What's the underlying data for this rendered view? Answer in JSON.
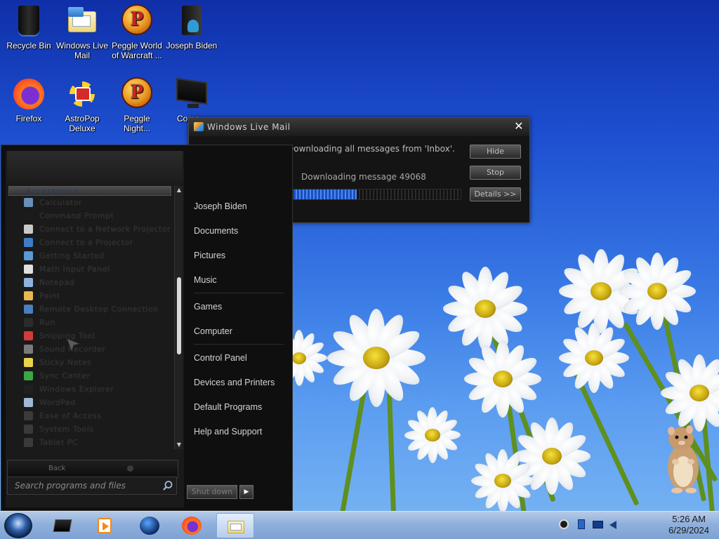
{
  "desktop": {
    "icons": [
      {
        "label": "Recycle Bin",
        "icon": "recycle-bin-icon"
      },
      {
        "label": "Windows Live Mail",
        "icon": "mail-icon"
      },
      {
        "label": "Peggle World of Warcraft ...",
        "icon": "peggle-icon"
      },
      {
        "label": "Joseph Biden",
        "icon": "user-folder-icon"
      },
      {
        "label": "Firefox",
        "icon": "firefox-icon"
      },
      {
        "label": "AstroPop Deluxe",
        "icon": "astropop-icon"
      },
      {
        "label": "Peggle Night...",
        "icon": "peggle-icon"
      },
      {
        "label": "Comp...",
        "icon": "computer-icon"
      }
    ]
  },
  "wlm_dialog": {
    "title": "Windows Live Mail",
    "status": "Downloading all messages from 'Inbox'.",
    "detail": "Downloading message 49068",
    "progress": 0.38,
    "buttons": {
      "hide": "Hide",
      "stop": "Stop",
      "details": "Details >>"
    }
  },
  "start_menu": {
    "folder": "Accessories",
    "programs": [
      {
        "label": "Calculator",
        "color": "#6a8fb8"
      },
      {
        "label": "Command Prompt",
        "color": "#1b1b1b"
      },
      {
        "label": "Connect to a Network Projector",
        "color": "#c9c9c9"
      },
      {
        "label": "Connect to a Projector",
        "color": "#3e7dc8"
      },
      {
        "label": "Getting Started",
        "color": "#5b9bd5"
      },
      {
        "label": "Math Input Panel",
        "color": "#e0e0e0"
      },
      {
        "label": "Notepad",
        "color": "#8fb3de"
      },
      {
        "label": "Paint",
        "color": "#e6b84f"
      },
      {
        "label": "Remote Desktop Connection",
        "color": "#4a7fc2"
      },
      {
        "label": "Run",
        "color": "#2b2b2b"
      },
      {
        "label": "Snipping Tool",
        "color": "#d23b3b"
      },
      {
        "label": "Sound Recorder",
        "color": "#7a7a7a"
      },
      {
        "label": "Sticky Notes",
        "color": "#e8d34a"
      },
      {
        "label": "Sync Center",
        "color": "#39a845"
      },
      {
        "label": "Windows Explorer",
        "color": "#1f1f1f"
      },
      {
        "label": "WordPad",
        "color": "#9fb8d6"
      },
      {
        "label": "Ease of Access",
        "color": "#3a3a3a"
      },
      {
        "label": "System Tools",
        "color": "#3a3a3a"
      },
      {
        "label": "Tablet PC",
        "color": "#3a3a3a"
      }
    ],
    "back_label": "Back",
    "search_placeholder": "Search programs and files",
    "right_items": [
      [
        "Joseph Biden",
        "Documents",
        "Pictures",
        "Music"
      ],
      [
        "Games",
        "Computer"
      ],
      [
        "Control Panel",
        "Devices and Printers",
        "Default Programs",
        "Help and Support"
      ]
    ],
    "shutdown_label": "Shut down"
  },
  "taskbar": {
    "pinned": [
      {
        "name": "taskbar-explorer",
        "icon": "black-box-icon"
      },
      {
        "name": "taskbar-media-player",
        "icon": "media-player-icon"
      },
      {
        "name": "taskbar-globe",
        "icon": "globe-icon"
      },
      {
        "name": "taskbar-firefox",
        "icon": "firefox-icon"
      },
      {
        "name": "taskbar-windows-live-mail",
        "icon": "mail-icon",
        "active": true
      }
    ],
    "tray_icons": [
      "steam-icon",
      "network-icon",
      "display-icon",
      "volume-icon"
    ],
    "time": "5:26 AM",
    "date": "6/29/2024"
  }
}
